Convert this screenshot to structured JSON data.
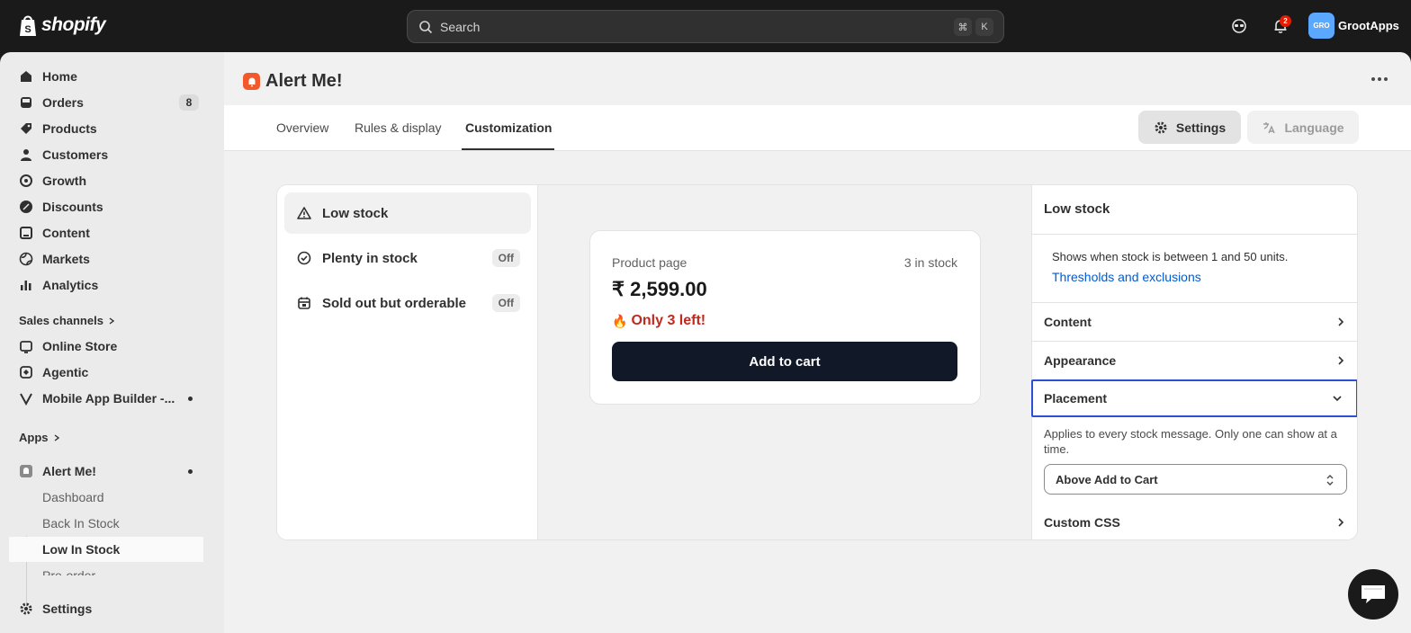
{
  "topbar": {
    "logo_text": "shopify",
    "search_placeholder": "Search",
    "shortcut_cmd": "⌘",
    "shortcut_key": "K",
    "notification_count": "2",
    "store_avatar": "GRO",
    "store_name": "GrootApps"
  },
  "sidebar": {
    "items": [
      {
        "label": "Home",
        "icon": "home-icon"
      },
      {
        "label": "Orders",
        "icon": "inbox-icon",
        "count": "8"
      },
      {
        "label": "Products",
        "icon": "tag-icon"
      },
      {
        "label": "Customers",
        "icon": "person-icon"
      },
      {
        "label": "Growth",
        "icon": "target-icon"
      },
      {
        "label": "Discounts",
        "icon": "discount-icon"
      },
      {
        "label": "Content",
        "icon": "content-icon"
      },
      {
        "label": "Markets",
        "icon": "globe-icon"
      },
      {
        "label": "Analytics",
        "icon": "bar-chart-icon"
      }
    ],
    "sales_channels_label": "Sales channels",
    "channels": [
      {
        "label": "Online Store",
        "icon": "store-icon"
      },
      {
        "label": "Agentic",
        "icon": "agentic-icon"
      },
      {
        "label": "Mobile App Builder -...",
        "icon": "v-logo-icon"
      }
    ],
    "apps_label": "Apps",
    "app": {
      "label": "Alert Me!"
    },
    "app_subitems": [
      "Dashboard",
      "Back In Stock",
      "Low In Stock",
      "Pre-order"
    ],
    "settings_label": "Settings"
  },
  "page": {
    "title": "Alert Me!",
    "tabs": [
      "Overview",
      "Rules & display",
      "Customization"
    ],
    "active_tab": "Customization",
    "settings_button": "Settings",
    "language_button": "Language"
  },
  "states": [
    {
      "label": "Low stock",
      "icon": "warning-icon",
      "active": true
    },
    {
      "label": "Plenty in stock",
      "icon": "check-circle-icon",
      "badge": "Off"
    },
    {
      "label": "Sold out but orderable",
      "icon": "calendar-icon",
      "badge": "Off"
    }
  ],
  "preview": {
    "label": "Product page",
    "stock": "3 in stock",
    "price": "₹ 2,599.00",
    "alert_emoji": "🔥",
    "alert_text": "Only 3 left!",
    "button": "Add to cart"
  },
  "panel": {
    "title": "Low stock",
    "description": "Shows when stock is between 1 and 50 units.",
    "link": "Thresholds and exclusions",
    "sections": [
      "Content",
      "Appearance",
      "Placement",
      "Custom CSS"
    ],
    "placement_description": "Applies to every stock message. Only one can show at a time.",
    "placement_value": "Above Add to Cart"
  },
  "colors": {
    "accent_link": "#005bd3",
    "alert_red": "#c4281c",
    "focus_border": "#2c4fd7",
    "app_icon": "#f1592a"
  }
}
